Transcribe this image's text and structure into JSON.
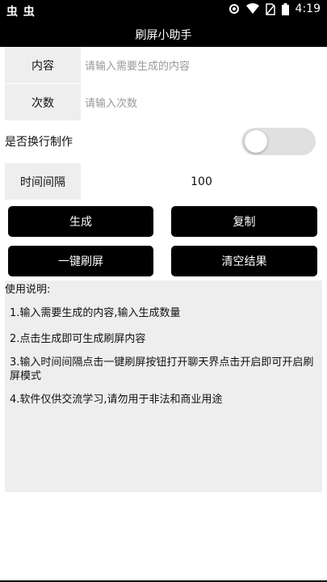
{
  "status_bar": {
    "left_icons": "虫 虫",
    "time": "4:19",
    "icons": [
      "settings-icon",
      "wifi-icon",
      "no-sim-icon",
      "battery-icon"
    ]
  },
  "title": "刷屏小助手",
  "form": {
    "content_label": "内容",
    "content_placeholder": "请输入需要生成的内容",
    "count_label": "次数",
    "count_placeholder": "请输入次数",
    "toggle_label": "是否换行制作",
    "toggle_on": false,
    "interval_label": "时间间隔",
    "interval_value": "100"
  },
  "buttons": {
    "generate": "生成",
    "copy": "复制",
    "one_key_spam": "一键刷屏",
    "clear_result": "清空结果"
  },
  "help": {
    "title": "使用说明:",
    "items": [
      "1.输入需要生成的内容,输入生成数量",
      "2.点击生成即可生成刷屏内容",
      "3.输入时间间隔点击一键刷屏按钮打开聊天界点击开启即可开启刷屏模式",
      "4.软件仅供交流学习,请勿用于非法和商业用途"
    ]
  },
  "colors": {
    "bar": "#000000",
    "label_bg": "#eeeeee",
    "switch_off": "#e0e0e0"
  }
}
